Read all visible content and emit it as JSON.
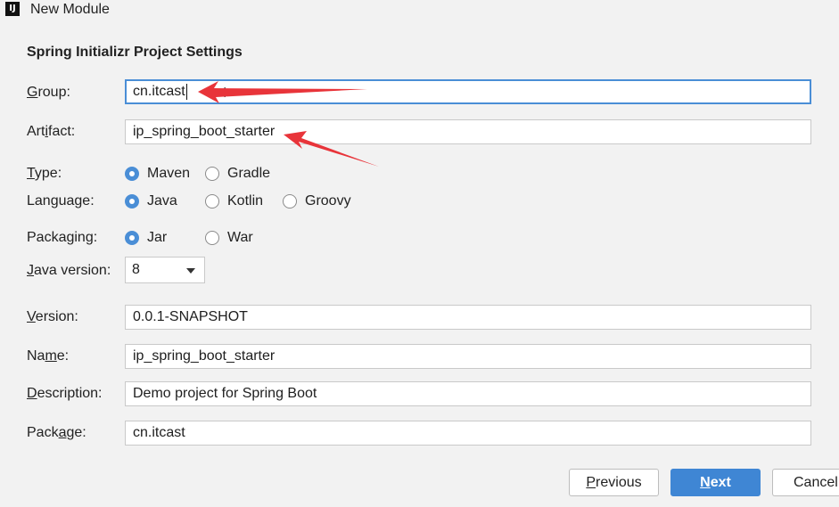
{
  "window": {
    "title": "New Module"
  },
  "section": {
    "title": "Spring Initializr Project Settings"
  },
  "group": {
    "label_u": "G",
    "label_rest": "roup:",
    "value": "cn.itcast"
  },
  "artifact": {
    "label_pre": "Art",
    "label_u": "i",
    "label_rest": "fact:",
    "value": "ip_spring_boot_starter"
  },
  "type": {
    "label_u": "T",
    "label_rest": "ype:",
    "options": [
      "Maven",
      "Gradle"
    ],
    "selected": "Maven"
  },
  "language": {
    "label_pre": "Lan",
    "label_u": "g",
    "label_rest": "uage:",
    "options": [
      "Java",
      "Kotlin",
      "Groovy"
    ],
    "selected": "Java"
  },
  "packaging": {
    "label_pre": "Packa",
    "label_u": "g",
    "label_rest": "ing:",
    "options": [
      "Jar",
      "War"
    ],
    "selected": "Jar"
  },
  "java_version": {
    "label_u": "J",
    "label_rest": "ava version:",
    "value": "8"
  },
  "version": {
    "label_u": "V",
    "label_rest": "ersion:",
    "value": "0.0.1-SNAPSHOT"
  },
  "name": {
    "label_pre": "Na",
    "label_u": "m",
    "label_rest": "e:",
    "value": "ip_spring_boot_starter"
  },
  "description": {
    "label_u": "D",
    "label_rest": "escription:",
    "value": "Demo project for Spring Boot"
  },
  "package": {
    "label_pre": "Pack",
    "label_u": "a",
    "label_rest": "ge:",
    "value": "cn.itcast"
  },
  "buttons": {
    "previous_u": "P",
    "previous_rest": "revious",
    "next_u": "N",
    "next_rest": "ext",
    "cancel": "Cancel"
  },
  "colors": {
    "accent": "#4a8ed6",
    "annotation": "#e8343a"
  },
  "icons": [
    "app-icon",
    "chevron-down-icon",
    "annotation-arrow",
    "text-cursor-icon"
  ]
}
